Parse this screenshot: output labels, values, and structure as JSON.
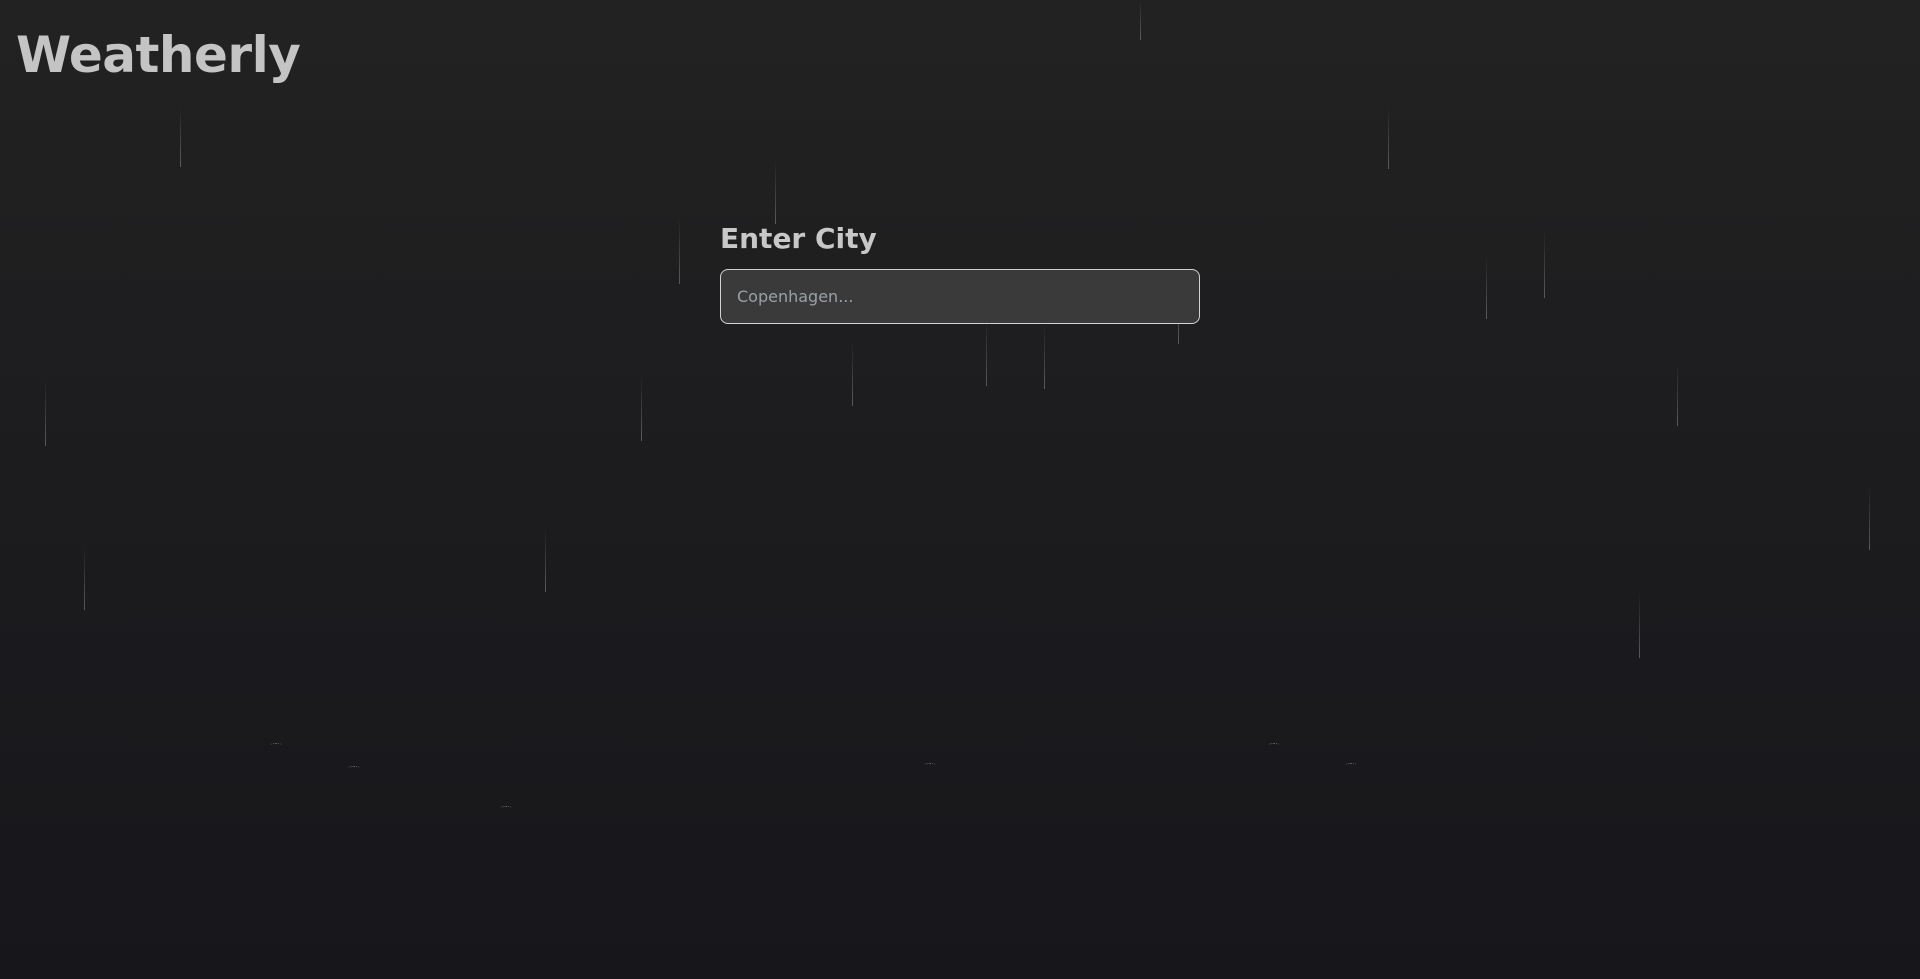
{
  "app": {
    "title": "Weatherly"
  },
  "search": {
    "label": "Enter City",
    "placeholder": "Copenhagen...",
    "value": ""
  },
  "theme": {
    "background_top": "#222222",
    "background_bottom": "#17171b",
    "text": "#c4c4c4",
    "input_bg": "#3a3a3a",
    "input_border": "#d2d2d2",
    "placeholder": "#9aa0a8"
  },
  "effects": {
    "animation": "rain"
  }
}
